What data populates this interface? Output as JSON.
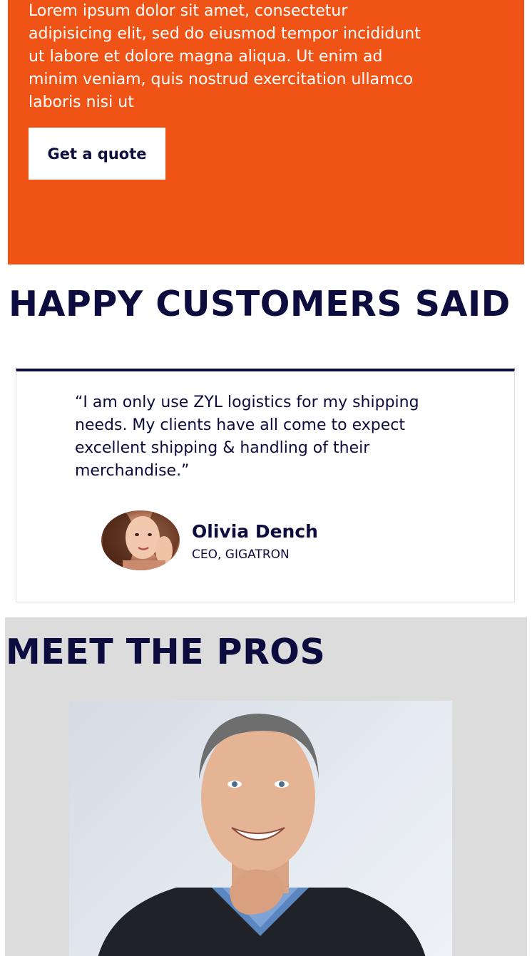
{
  "hero": {
    "body_text": "Lorem ipsum dolor sit amet, consectetur adipisicing elit, sed do eiusmod tempor incididunt ut labore et dolore magna aliqua. Ut enim ad minim veniam, quis nostrud exercitation ullamco laboris nisi ut",
    "cta_label": "Get a quote",
    "background_color": "#ef5316"
  },
  "testimonials": {
    "title": "HAPPY CUSTOMERS SAID",
    "quote": "“I am only use ZYL logistics for my shipping needs. My clients have all come to expect excellent shipping & handling of their merchandise.”",
    "author_name": "Olivia Dench",
    "author_role": "CEO, GIGATRON"
  },
  "pros": {
    "title": "MEET THE PROS",
    "background_color": "#dcdcdc"
  },
  "colors": {
    "navy": "#0c0c3e",
    "accent": "#ef5316"
  }
}
